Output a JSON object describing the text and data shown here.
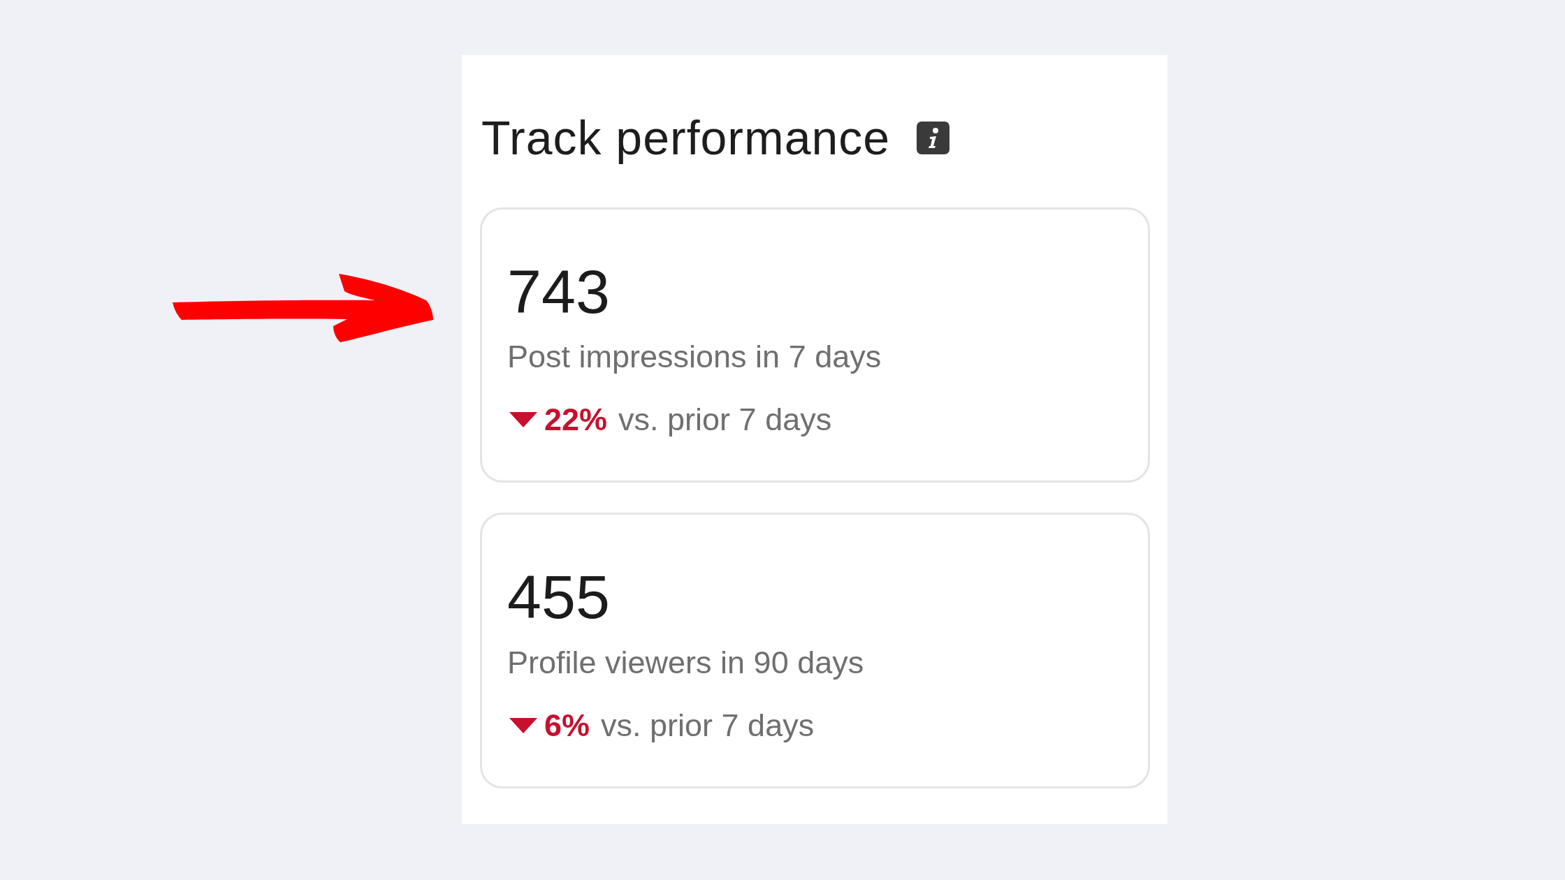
{
  "panel": {
    "title": "Track performance"
  },
  "metrics": [
    {
      "value": "743",
      "label": "Post impressions in 7 days",
      "change": {
        "kind": "decrease",
        "percent": "22%",
        "comparison": "vs. prior 7 days"
      }
    },
    {
      "value": "455",
      "label": "Profile viewers in 90 days",
      "change": {
        "kind": "decrease",
        "percent": "6%",
        "comparison": "vs. prior 7 days"
      }
    }
  ]
}
